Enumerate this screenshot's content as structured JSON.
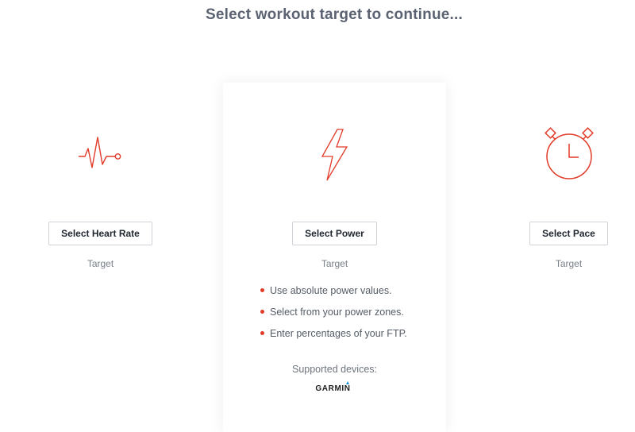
{
  "header": {
    "title": "Select workout target to continue..."
  },
  "options": {
    "heart_rate": {
      "icon": "heart-rate-icon",
      "button_label": "Select Heart Rate",
      "subtitle": "Target"
    },
    "power": {
      "icon": "lightning-bolt-icon",
      "button_label": "Select Power",
      "subtitle": "Target",
      "features": [
        "Use absolute power values.",
        "Select from your power zones.",
        "Enter percentages of your FTP."
      ],
      "supported_label": "Supported devices:",
      "device_logo": "GARMIN"
    },
    "pace": {
      "icon": "stopwatch-icon",
      "button_label": "Select Pace",
      "subtitle": "Target"
    }
  },
  "colors": {
    "accent": "#e23b2a",
    "title": "#5b6372",
    "garmin_triangle": "#1b8fd6"
  }
}
